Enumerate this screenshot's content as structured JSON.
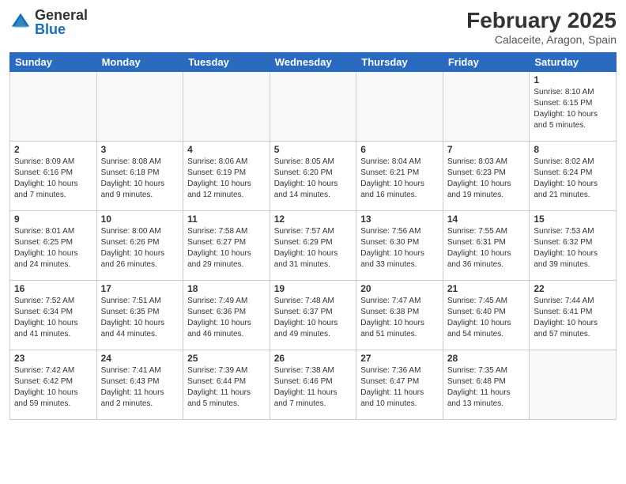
{
  "header": {
    "logo_general": "General",
    "logo_blue": "Blue",
    "month_year": "February 2025",
    "location": "Calaceite, Aragon, Spain"
  },
  "weekdays": [
    "Sunday",
    "Monday",
    "Tuesday",
    "Wednesday",
    "Thursday",
    "Friday",
    "Saturday"
  ],
  "weeks": [
    [
      {
        "day": "",
        "info": ""
      },
      {
        "day": "",
        "info": ""
      },
      {
        "day": "",
        "info": ""
      },
      {
        "day": "",
        "info": ""
      },
      {
        "day": "",
        "info": ""
      },
      {
        "day": "",
        "info": ""
      },
      {
        "day": "1",
        "info": "Sunrise: 8:10 AM\nSunset: 6:15 PM\nDaylight: 10 hours\nand 5 minutes."
      }
    ],
    [
      {
        "day": "2",
        "info": "Sunrise: 8:09 AM\nSunset: 6:16 PM\nDaylight: 10 hours\nand 7 minutes."
      },
      {
        "day": "3",
        "info": "Sunrise: 8:08 AM\nSunset: 6:18 PM\nDaylight: 10 hours\nand 9 minutes."
      },
      {
        "day": "4",
        "info": "Sunrise: 8:06 AM\nSunset: 6:19 PM\nDaylight: 10 hours\nand 12 minutes."
      },
      {
        "day": "5",
        "info": "Sunrise: 8:05 AM\nSunset: 6:20 PM\nDaylight: 10 hours\nand 14 minutes."
      },
      {
        "day": "6",
        "info": "Sunrise: 8:04 AM\nSunset: 6:21 PM\nDaylight: 10 hours\nand 16 minutes."
      },
      {
        "day": "7",
        "info": "Sunrise: 8:03 AM\nSunset: 6:23 PM\nDaylight: 10 hours\nand 19 minutes."
      },
      {
        "day": "8",
        "info": "Sunrise: 8:02 AM\nSunset: 6:24 PM\nDaylight: 10 hours\nand 21 minutes."
      }
    ],
    [
      {
        "day": "9",
        "info": "Sunrise: 8:01 AM\nSunset: 6:25 PM\nDaylight: 10 hours\nand 24 minutes."
      },
      {
        "day": "10",
        "info": "Sunrise: 8:00 AM\nSunset: 6:26 PM\nDaylight: 10 hours\nand 26 minutes."
      },
      {
        "day": "11",
        "info": "Sunrise: 7:58 AM\nSunset: 6:27 PM\nDaylight: 10 hours\nand 29 minutes."
      },
      {
        "day": "12",
        "info": "Sunrise: 7:57 AM\nSunset: 6:29 PM\nDaylight: 10 hours\nand 31 minutes."
      },
      {
        "day": "13",
        "info": "Sunrise: 7:56 AM\nSunset: 6:30 PM\nDaylight: 10 hours\nand 33 minutes."
      },
      {
        "day": "14",
        "info": "Sunrise: 7:55 AM\nSunset: 6:31 PM\nDaylight: 10 hours\nand 36 minutes."
      },
      {
        "day": "15",
        "info": "Sunrise: 7:53 AM\nSunset: 6:32 PM\nDaylight: 10 hours\nand 39 minutes."
      }
    ],
    [
      {
        "day": "16",
        "info": "Sunrise: 7:52 AM\nSunset: 6:34 PM\nDaylight: 10 hours\nand 41 minutes."
      },
      {
        "day": "17",
        "info": "Sunrise: 7:51 AM\nSunset: 6:35 PM\nDaylight: 10 hours\nand 44 minutes."
      },
      {
        "day": "18",
        "info": "Sunrise: 7:49 AM\nSunset: 6:36 PM\nDaylight: 10 hours\nand 46 minutes."
      },
      {
        "day": "19",
        "info": "Sunrise: 7:48 AM\nSunset: 6:37 PM\nDaylight: 10 hours\nand 49 minutes."
      },
      {
        "day": "20",
        "info": "Sunrise: 7:47 AM\nSunset: 6:38 PM\nDaylight: 10 hours\nand 51 minutes."
      },
      {
        "day": "21",
        "info": "Sunrise: 7:45 AM\nSunset: 6:40 PM\nDaylight: 10 hours\nand 54 minutes."
      },
      {
        "day": "22",
        "info": "Sunrise: 7:44 AM\nSunset: 6:41 PM\nDaylight: 10 hours\nand 57 minutes."
      }
    ],
    [
      {
        "day": "23",
        "info": "Sunrise: 7:42 AM\nSunset: 6:42 PM\nDaylight: 10 hours\nand 59 minutes."
      },
      {
        "day": "24",
        "info": "Sunrise: 7:41 AM\nSunset: 6:43 PM\nDaylight: 11 hours\nand 2 minutes."
      },
      {
        "day": "25",
        "info": "Sunrise: 7:39 AM\nSunset: 6:44 PM\nDaylight: 11 hours\nand 5 minutes."
      },
      {
        "day": "26",
        "info": "Sunrise: 7:38 AM\nSunset: 6:46 PM\nDaylight: 11 hours\nand 7 minutes."
      },
      {
        "day": "27",
        "info": "Sunrise: 7:36 AM\nSunset: 6:47 PM\nDaylight: 11 hours\nand 10 minutes."
      },
      {
        "day": "28",
        "info": "Sunrise: 7:35 AM\nSunset: 6:48 PM\nDaylight: 11 hours\nand 13 minutes."
      },
      {
        "day": "",
        "info": ""
      }
    ]
  ]
}
